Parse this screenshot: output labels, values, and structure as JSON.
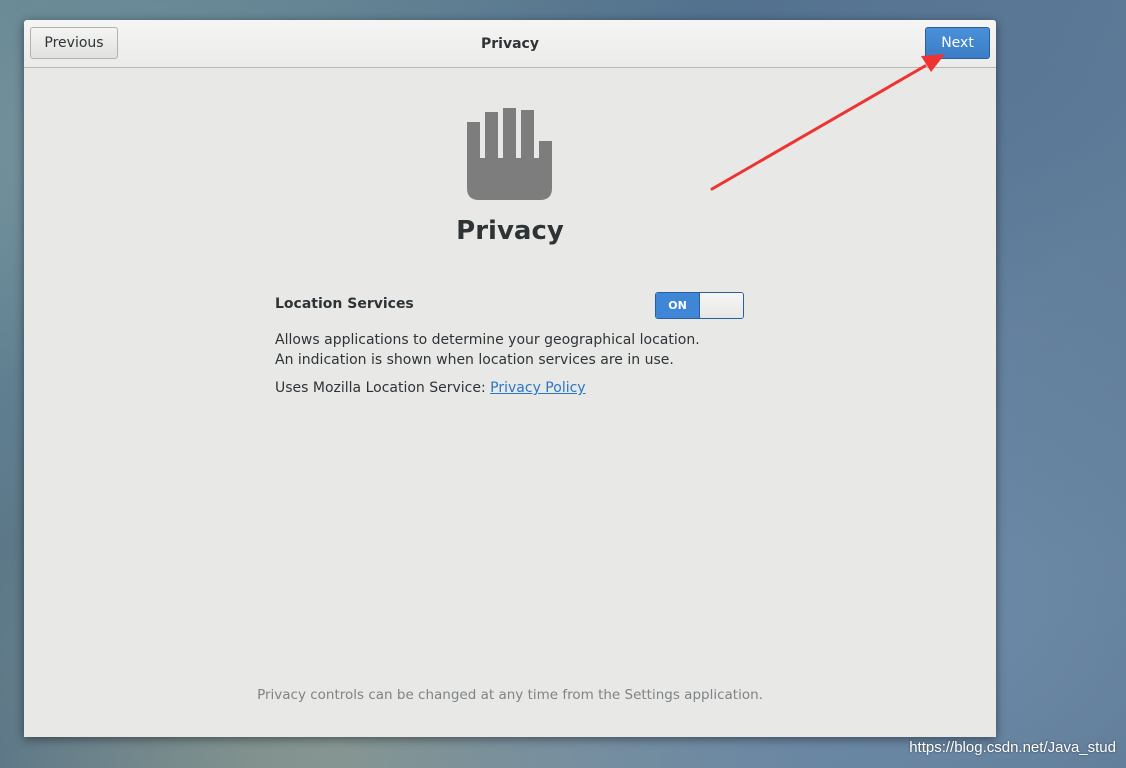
{
  "header": {
    "title": "Privacy",
    "previous_label": "Previous",
    "next_label": "Next"
  },
  "page": {
    "icon": "hand-stop-icon",
    "title": "Privacy"
  },
  "location_services": {
    "label": "Location Services",
    "toggle_state": "ON",
    "description": "Allows applications to determine your geographical location. An indication is shown when location services are in use.",
    "service_prefix": "Uses Mozilla Location Service: ",
    "policy_link": "Privacy Policy"
  },
  "footer": {
    "note": "Privacy controls can be changed at any time from the Settings application."
  },
  "watermark": "https://blog.csdn.net/Java_stud",
  "colors": {
    "accent": "#3f87d6",
    "link": "#2a76c6",
    "annotation_arrow": "#ee3333",
    "window_bg": "#e8e8e7",
    "icon": "#7d7d7d"
  }
}
